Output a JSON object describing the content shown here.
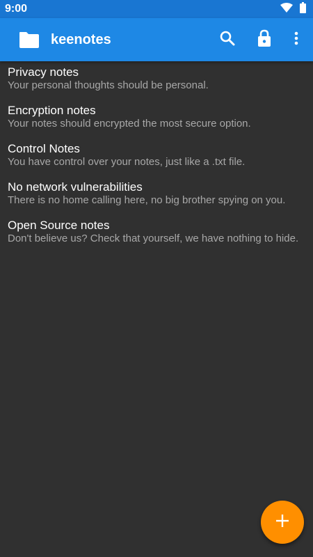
{
  "status_bar": {
    "time": "9:00",
    "icons": [
      "wifi-icon",
      "battery-icon"
    ]
  },
  "app_bar": {
    "title": "keenotes",
    "app_icon": "folder-icon",
    "actions": [
      "search-icon",
      "lock-icon",
      "more-vert-icon"
    ]
  },
  "notes": [
    {
      "title": "Privacy notes",
      "subtitle": "Your personal thoughts should be personal."
    },
    {
      "title": "Encryption notes",
      "subtitle": "Your notes should encrypted the most secure option."
    },
    {
      "title": "Control Notes",
      "subtitle": "You have control over your notes, just like a .txt file."
    },
    {
      "title": "No network vulnerabilities",
      "subtitle": "There is no home calling here, no big brother spying on you."
    },
    {
      "title": "Open Source notes",
      "subtitle": "Don't believe us? Check that yourself, we have nothing to hide."
    }
  ],
  "fab": {
    "icon": "add-icon"
  },
  "colors": {
    "status_bar": "#1976d2",
    "app_bar": "#1e88e5",
    "background": "#303030",
    "fab": "#ff8f00",
    "subtitle": "#a8a8a8"
  }
}
